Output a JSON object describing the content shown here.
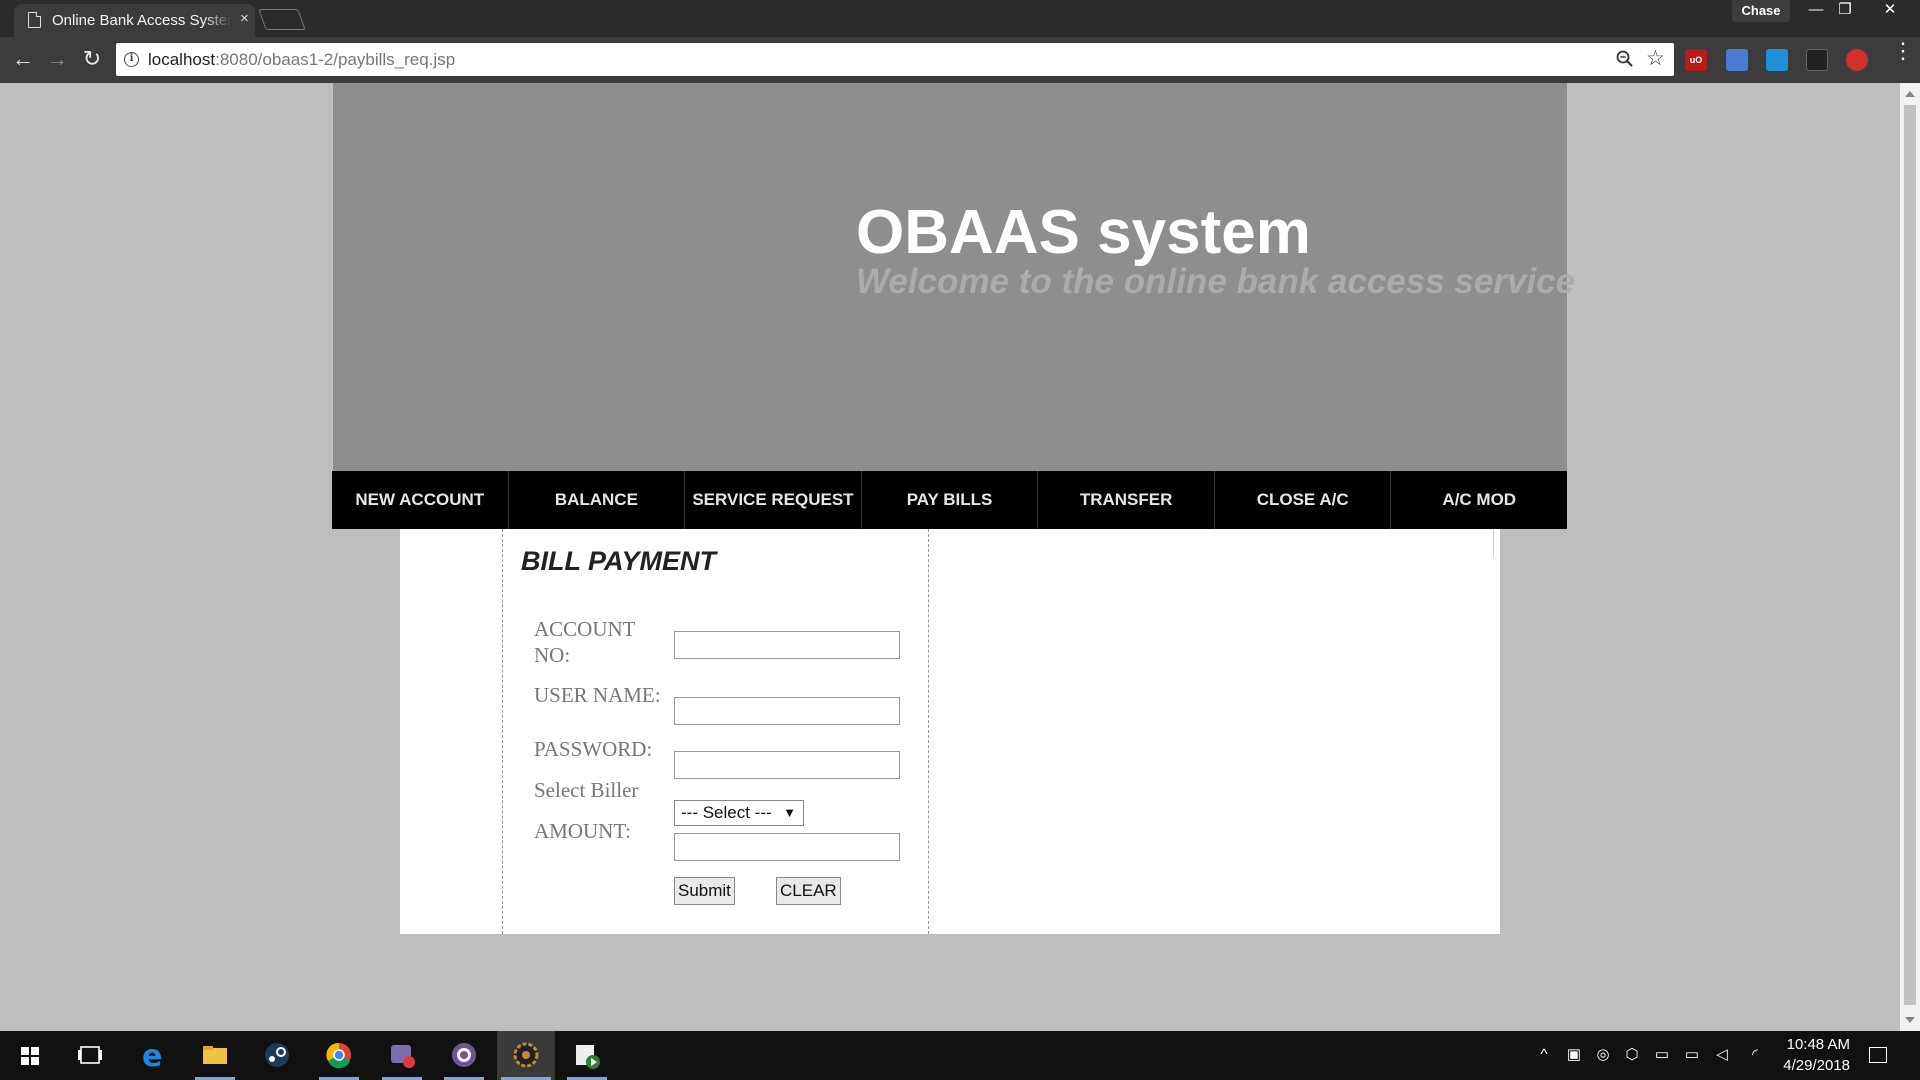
{
  "browser": {
    "tab_title": "Online Bank Access System",
    "tab_close": "×",
    "profile_name": "Chase",
    "window_min": "—",
    "window_restore": "❐",
    "window_close": "✕",
    "url_host": "localhost",
    "url_rest": ":8080/obaas1-2/paybills_req.jsp",
    "nav_back": "←",
    "nav_forward": "→",
    "nav_reload": "↻",
    "star": "☆",
    "menu": "⋮"
  },
  "site": {
    "title": "OBAAS system",
    "tagline": "Welcome to the online bank access service"
  },
  "nav": {
    "items": [
      "NEW ACCOUNT",
      "BALANCE",
      "SERVICE REQUEST",
      "PAY BILLS",
      "TRANSFER",
      "CLOSE A/C",
      "A/C MOD"
    ]
  },
  "form": {
    "title": "BILL PAYMENT",
    "account_label": "ACCOUNT NO:",
    "account_value": "",
    "username_label": "USER NAME:",
    "username_value": "",
    "password_label": "PASSWORD:",
    "password_value": "",
    "biller_label": "Select Biller",
    "biller_selected": "--- Select ---",
    "amount_label": "AMOUNT:",
    "amount_value": "",
    "submit_label": "Submit",
    "clear_label": "CLEAR"
  },
  "taskbar": {
    "time": "10:48 AM",
    "date": "4/29/2018",
    "apps": [
      "start-icon",
      "task-view-icon",
      "edge-icon",
      "file-explorer-icon",
      "steam-icon",
      "chrome-icon",
      "screen-capture-icon",
      "github-icon",
      "settings-gear-icon",
      "media-player-icon"
    ]
  },
  "colors": {
    "banner": "#8e8e8e",
    "nav_bg": "#000000",
    "page_bg": "#bebebe",
    "tagline": "#acacac"
  }
}
